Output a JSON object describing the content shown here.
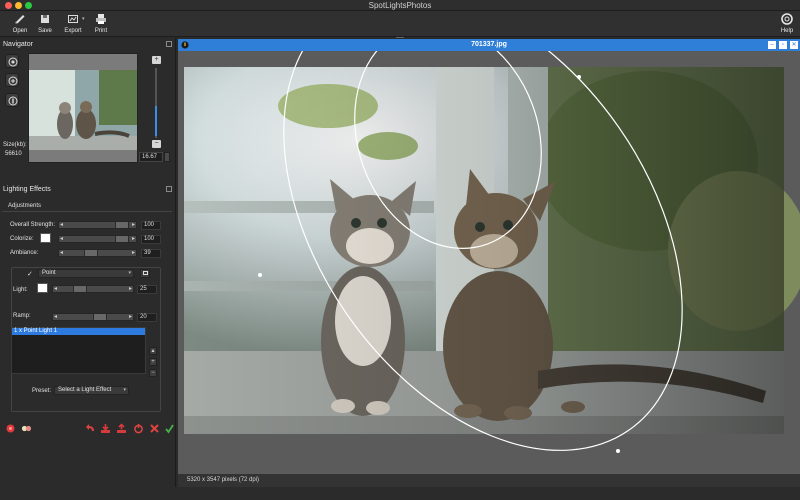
{
  "app": {
    "title": "SpotLightsPhotos"
  },
  "toolbar": {
    "open_label": "Open",
    "save_label": "Save",
    "export_label": "Export",
    "print_label": "Print",
    "help_label": "Help"
  },
  "navigator": {
    "title": "Navigator",
    "size_label": "Size(kb):",
    "size_value": "56610",
    "zoom_value": "16.67",
    "zoom_plus_icon": "plus-icon",
    "zoom_minus_icon": "minus-icon"
  },
  "lighting": {
    "title": "Lighting Effects",
    "tab": "Adjustments",
    "overall_strength_label": "Overall Strength:",
    "overall_strength_value": "100",
    "colorize_label": "Colorize:",
    "colorize_value": "100",
    "ambiance_label": "Ambiance:",
    "ambiance_value": "39",
    "light_type": "Point",
    "light_label": "Light:",
    "light_value": "25",
    "ramp_label": "Ramp:",
    "ramp_value": "20",
    "lights_list": [
      "1   x Point Light 1"
    ],
    "preset_label": "Preset:",
    "preset_value": "Select a Light Effect"
  },
  "image_window": {
    "filename": "701337.jpg",
    "status": "5320 x 3547 pixels (72 dpi)"
  },
  "colors": {
    "accent": "#2f7fd8",
    "selection": "#2e7be0",
    "panel": "#2b2b2b"
  }
}
